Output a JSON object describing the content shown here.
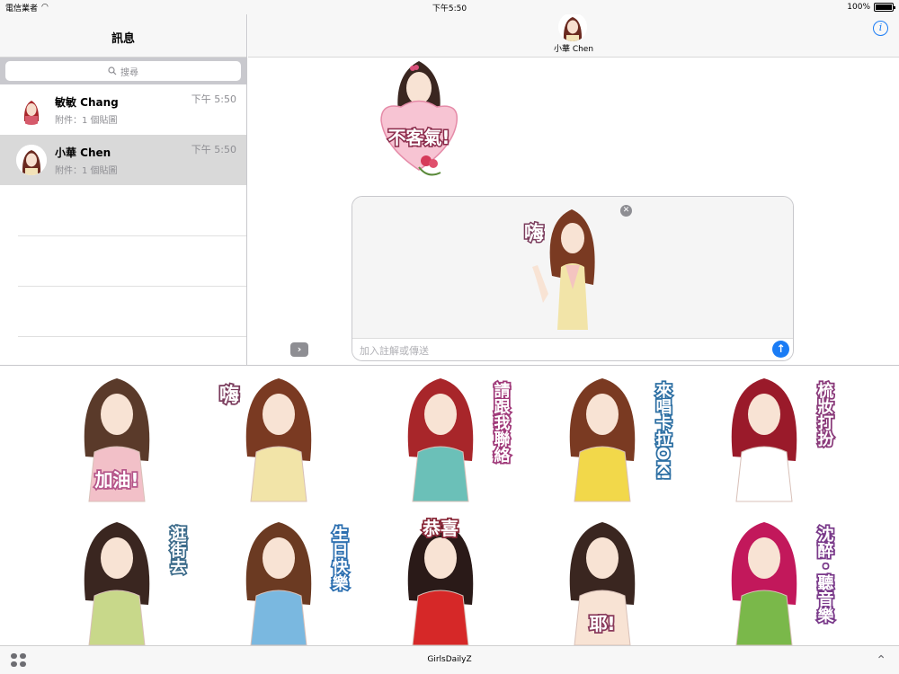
{
  "status": {
    "carrier": "電信業者",
    "time": "下午5:50",
    "battery": "100%"
  },
  "sidebar": {
    "title": "訊息",
    "search_placeholder": "搜尋",
    "conversations": [
      {
        "name": "敏敏 Chang",
        "preview": "附件：1 個貼圖",
        "time": "下午 5:50"
      },
      {
        "name": "小華 Chen",
        "preview": "附件：1 個貼圖",
        "time": "下午 5:50"
      }
    ]
  },
  "chat": {
    "contact": "小華 Chen",
    "sent_sticker_text": "不客氣!",
    "preview_sticker_text": "嗨",
    "compose_placeholder": "加入註解或傳送"
  },
  "drawer": {
    "app_name": "GirlsDailyZ",
    "stickers": [
      {
        "text": "加油!",
        "color": "#b5568a"
      },
      {
        "text": "嗨",
        "color": "#7a3b5c"
      },
      {
        "text": "請跟我聯絡",
        "color": "#a03a7a"
      },
      {
        "text": "來唱卡拉OK!",
        "color": "#2d6fa3"
      },
      {
        "text": "梳妝打扮",
        "color": "#8a3a7a"
      },
      {
        "text": "逛街去",
        "color": "#3c6b8a"
      },
      {
        "text": "生日快樂",
        "color": "#2c6fb0"
      },
      {
        "text": "恭喜",
        "color": "#8a2a3a"
      },
      {
        "text": "耶!",
        "color": "#8a3b5c"
      },
      {
        "text": "沈醉・聽音樂",
        "color": "#7a3a8a"
      }
    ]
  },
  "icons": {
    "search": "search-icon",
    "info": "info-icon",
    "send": "send-icon",
    "remove": "close-icon",
    "expand": "chevron-right-icon",
    "apps": "app-grid-icon",
    "collapse": "chevron-up-icon"
  }
}
